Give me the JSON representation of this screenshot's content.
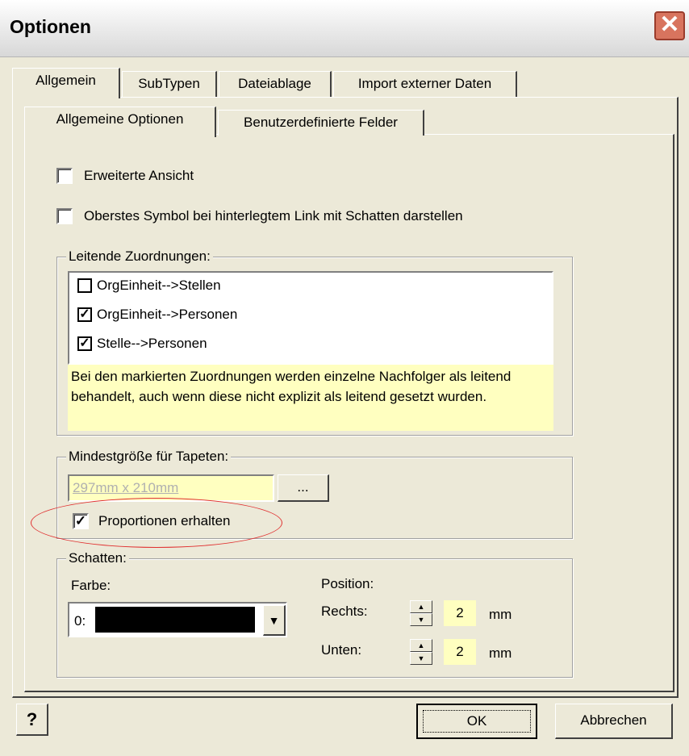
{
  "window": {
    "title": "Optionen"
  },
  "tabs": [
    "Allgemein",
    "SubTypen",
    "Dateiablage",
    "Import externer Daten"
  ],
  "subtabs": [
    "Allgemeine Optionen",
    "Benutzerdefinierte Felder"
  ],
  "options": {
    "erweiterte_ansicht": "Erweiterte Ansicht",
    "oberstes_symbol": "Oberstes Symbol bei hinterlegtem Link mit Schatten darstellen"
  },
  "leitende": {
    "label": "Leitende Zuordnungen:",
    "items": [
      {
        "label": "OrgEinheit-->Stellen",
        "checked": false,
        "mark": ""
      },
      {
        "label": "OrgEinheit-->Personen",
        "checked": true,
        "mark": "✓"
      },
      {
        "label": "Stelle-->Personen",
        "checked": true,
        "mark": "✓"
      }
    ],
    "note": "Bei den markierten Zuordnungen werden einzelne Nachfolger als leitend behandelt, auch wenn diese nicht explizit als leitend gesetzt wurden."
  },
  "tapeten": {
    "label": "Mindestgröße für Tapeten:",
    "value": "297mm  x  210mm",
    "browse": "...",
    "proportionen": "Proportionen erhalten",
    "proportionen_mark": "✓"
  },
  "schatten": {
    "label": "Schatten:",
    "farbe_label": "Farbe:",
    "farbe_value": "0:",
    "farbe_color": "#000000",
    "position_label": "Position:",
    "rechts_label": "Rechts:",
    "rechts_value": "2",
    "unten_label": "Unten:",
    "unten_value": "2",
    "unit": "mm"
  },
  "buttons": {
    "help": "?",
    "ok": "OK",
    "cancel": "Abbrechen"
  },
  "colors": {
    "note_bg": "#ffffc0",
    "highlight": "#e03030"
  },
  "icons": {
    "close": "close-icon",
    "help": "help-icon",
    "dropdown": "chevron-down-icon"
  }
}
